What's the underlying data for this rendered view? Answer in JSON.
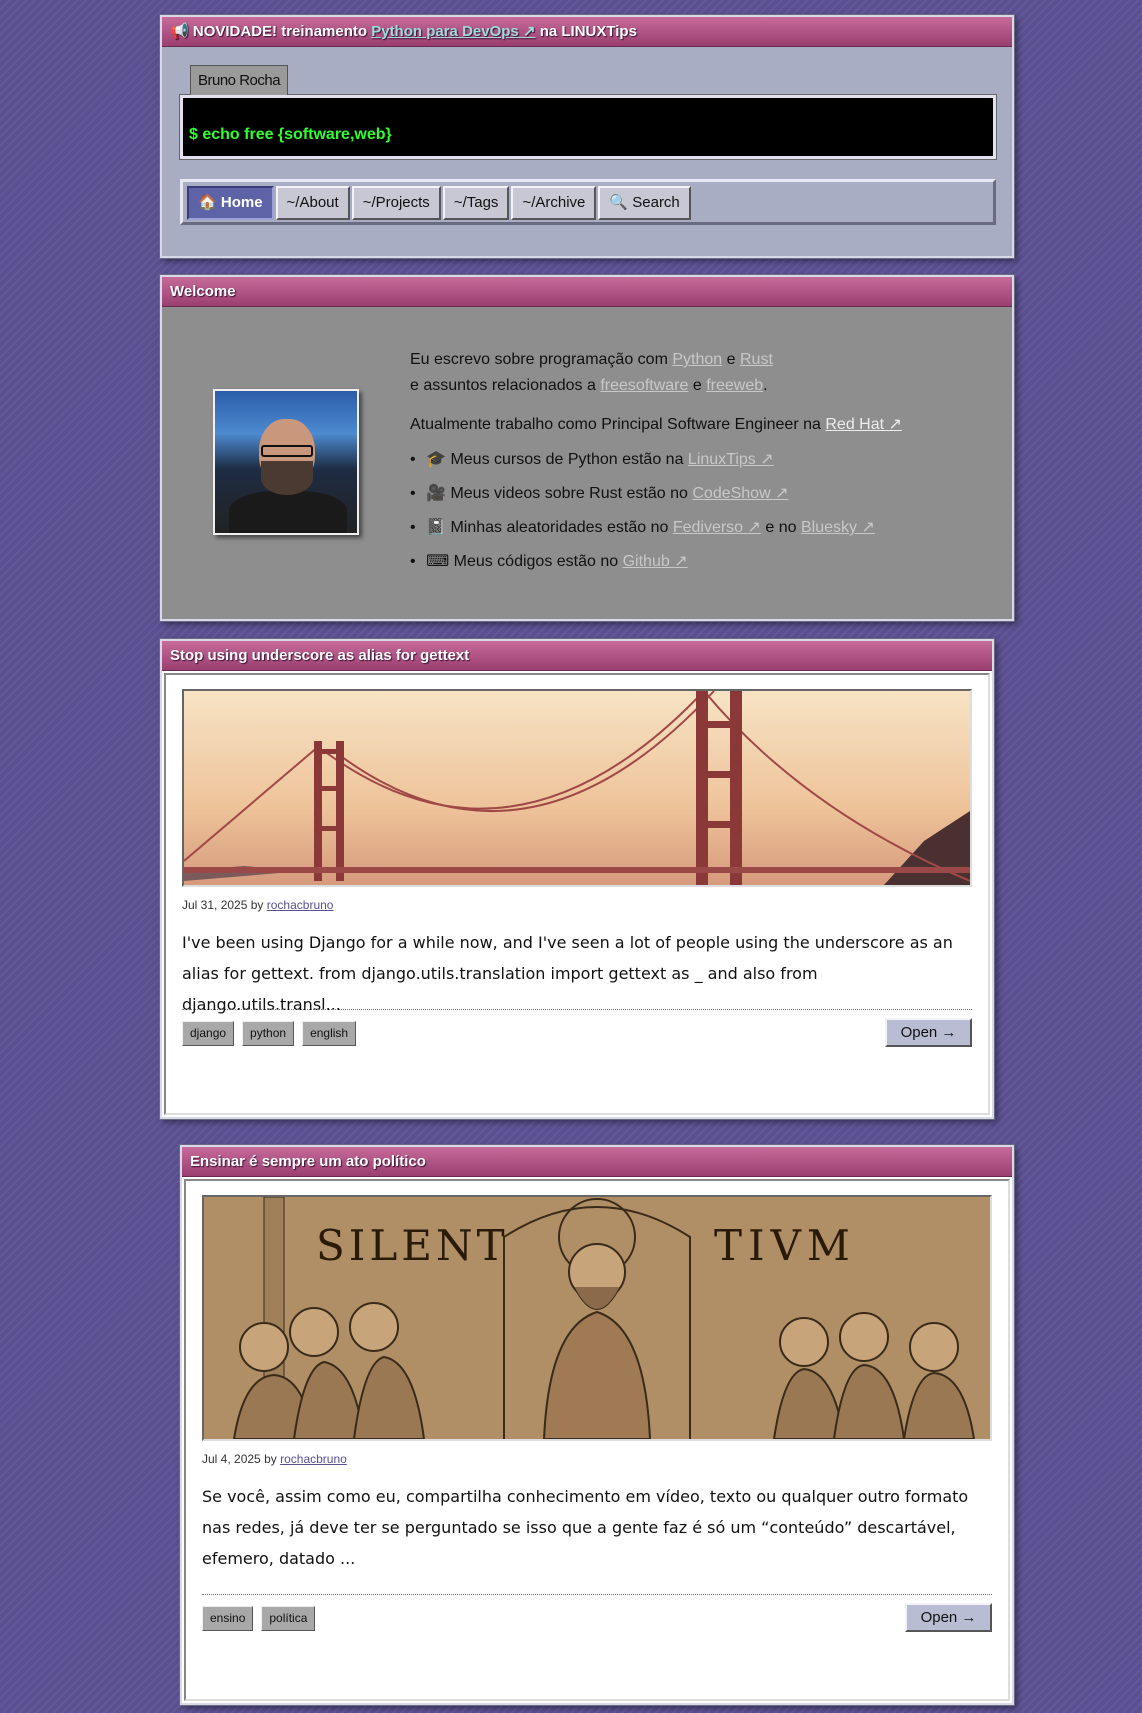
{
  "announcement": {
    "icon": "📢",
    "prefix": "NOVIDADE! treinamento",
    "link_text": "Python para DevOps",
    "suffix": "na LINUXTips"
  },
  "terminal": {
    "tab_label": "Bruno Rocha",
    "prompt": "$ echo free {software,web}"
  },
  "nav": [
    {
      "icon": "🏠",
      "label": "Home",
      "active": true
    },
    {
      "label": "~/About"
    },
    {
      "label": "~/Projects"
    },
    {
      "label": "~/Tags"
    },
    {
      "label": "~/Archive"
    },
    {
      "icon": "🔍",
      "label": "Search"
    }
  ],
  "welcome": {
    "title": "Welcome",
    "line1": {
      "text": "Eu escrevo sobre programação com",
      "link1": "Python",
      "and": "e",
      "link2": "Rust"
    },
    "line2": {
      "text": "e assuntos relacionados a",
      "link1": "freesoftware",
      "and": "e",
      "link2": "freeweb",
      "end": "."
    },
    "work": {
      "text": "Atualmente trabalho como Principal Software Engineer na",
      "link": "Red Hat"
    },
    "items": [
      {
        "icon": "🎓",
        "text": "Meus cursos de Python estão na",
        "link": "LinuxTips"
      },
      {
        "icon": "🎥",
        "text": "Meus videos sobre Rust estão no",
        "link": "CodeShow"
      },
      {
        "icon": "📓",
        "text": "Minhas aleatoridades estão no",
        "link": "Fediverso",
        "mid": "e no",
        "link2": "Bluesky"
      },
      {
        "icon": "⌨",
        "text": "Meus códigos estão no",
        "link": "Github"
      }
    ]
  },
  "posts": [
    {
      "title": "Stop using underscore as alias for gettext",
      "date": "Jul 31, 2025",
      "by": "by",
      "author": "rochacbruno",
      "excerpt": "I've been using Django for a while now, and I've seen a lot of people using the underscore as an alias for gettext. from django.utils.translation import gettext as _ and also from django.utils.transl...",
      "tags": [
        "django",
        "python",
        "english"
      ],
      "open_label": "Open →"
    },
    {
      "title": "Ensinar é sempre um ato político",
      "date": "Jul 4, 2025",
      "by": "by",
      "author": "rochacbruno",
      "excerpt": "Se você, assim como eu, compartilha conhecimento em vídeo, texto ou qualquer outro formato nas redes, já deve ter se perguntado se isso que a gente faz é só um “conteúdo” descartável, efemero, datado ...",
      "cover_text_left": "SILENT",
      "cover_text_right": "TIVM",
      "tags": [
        "ensino",
        "política"
      ],
      "open_label": "Open →"
    }
  ],
  "external_link_icon": "↗"
}
